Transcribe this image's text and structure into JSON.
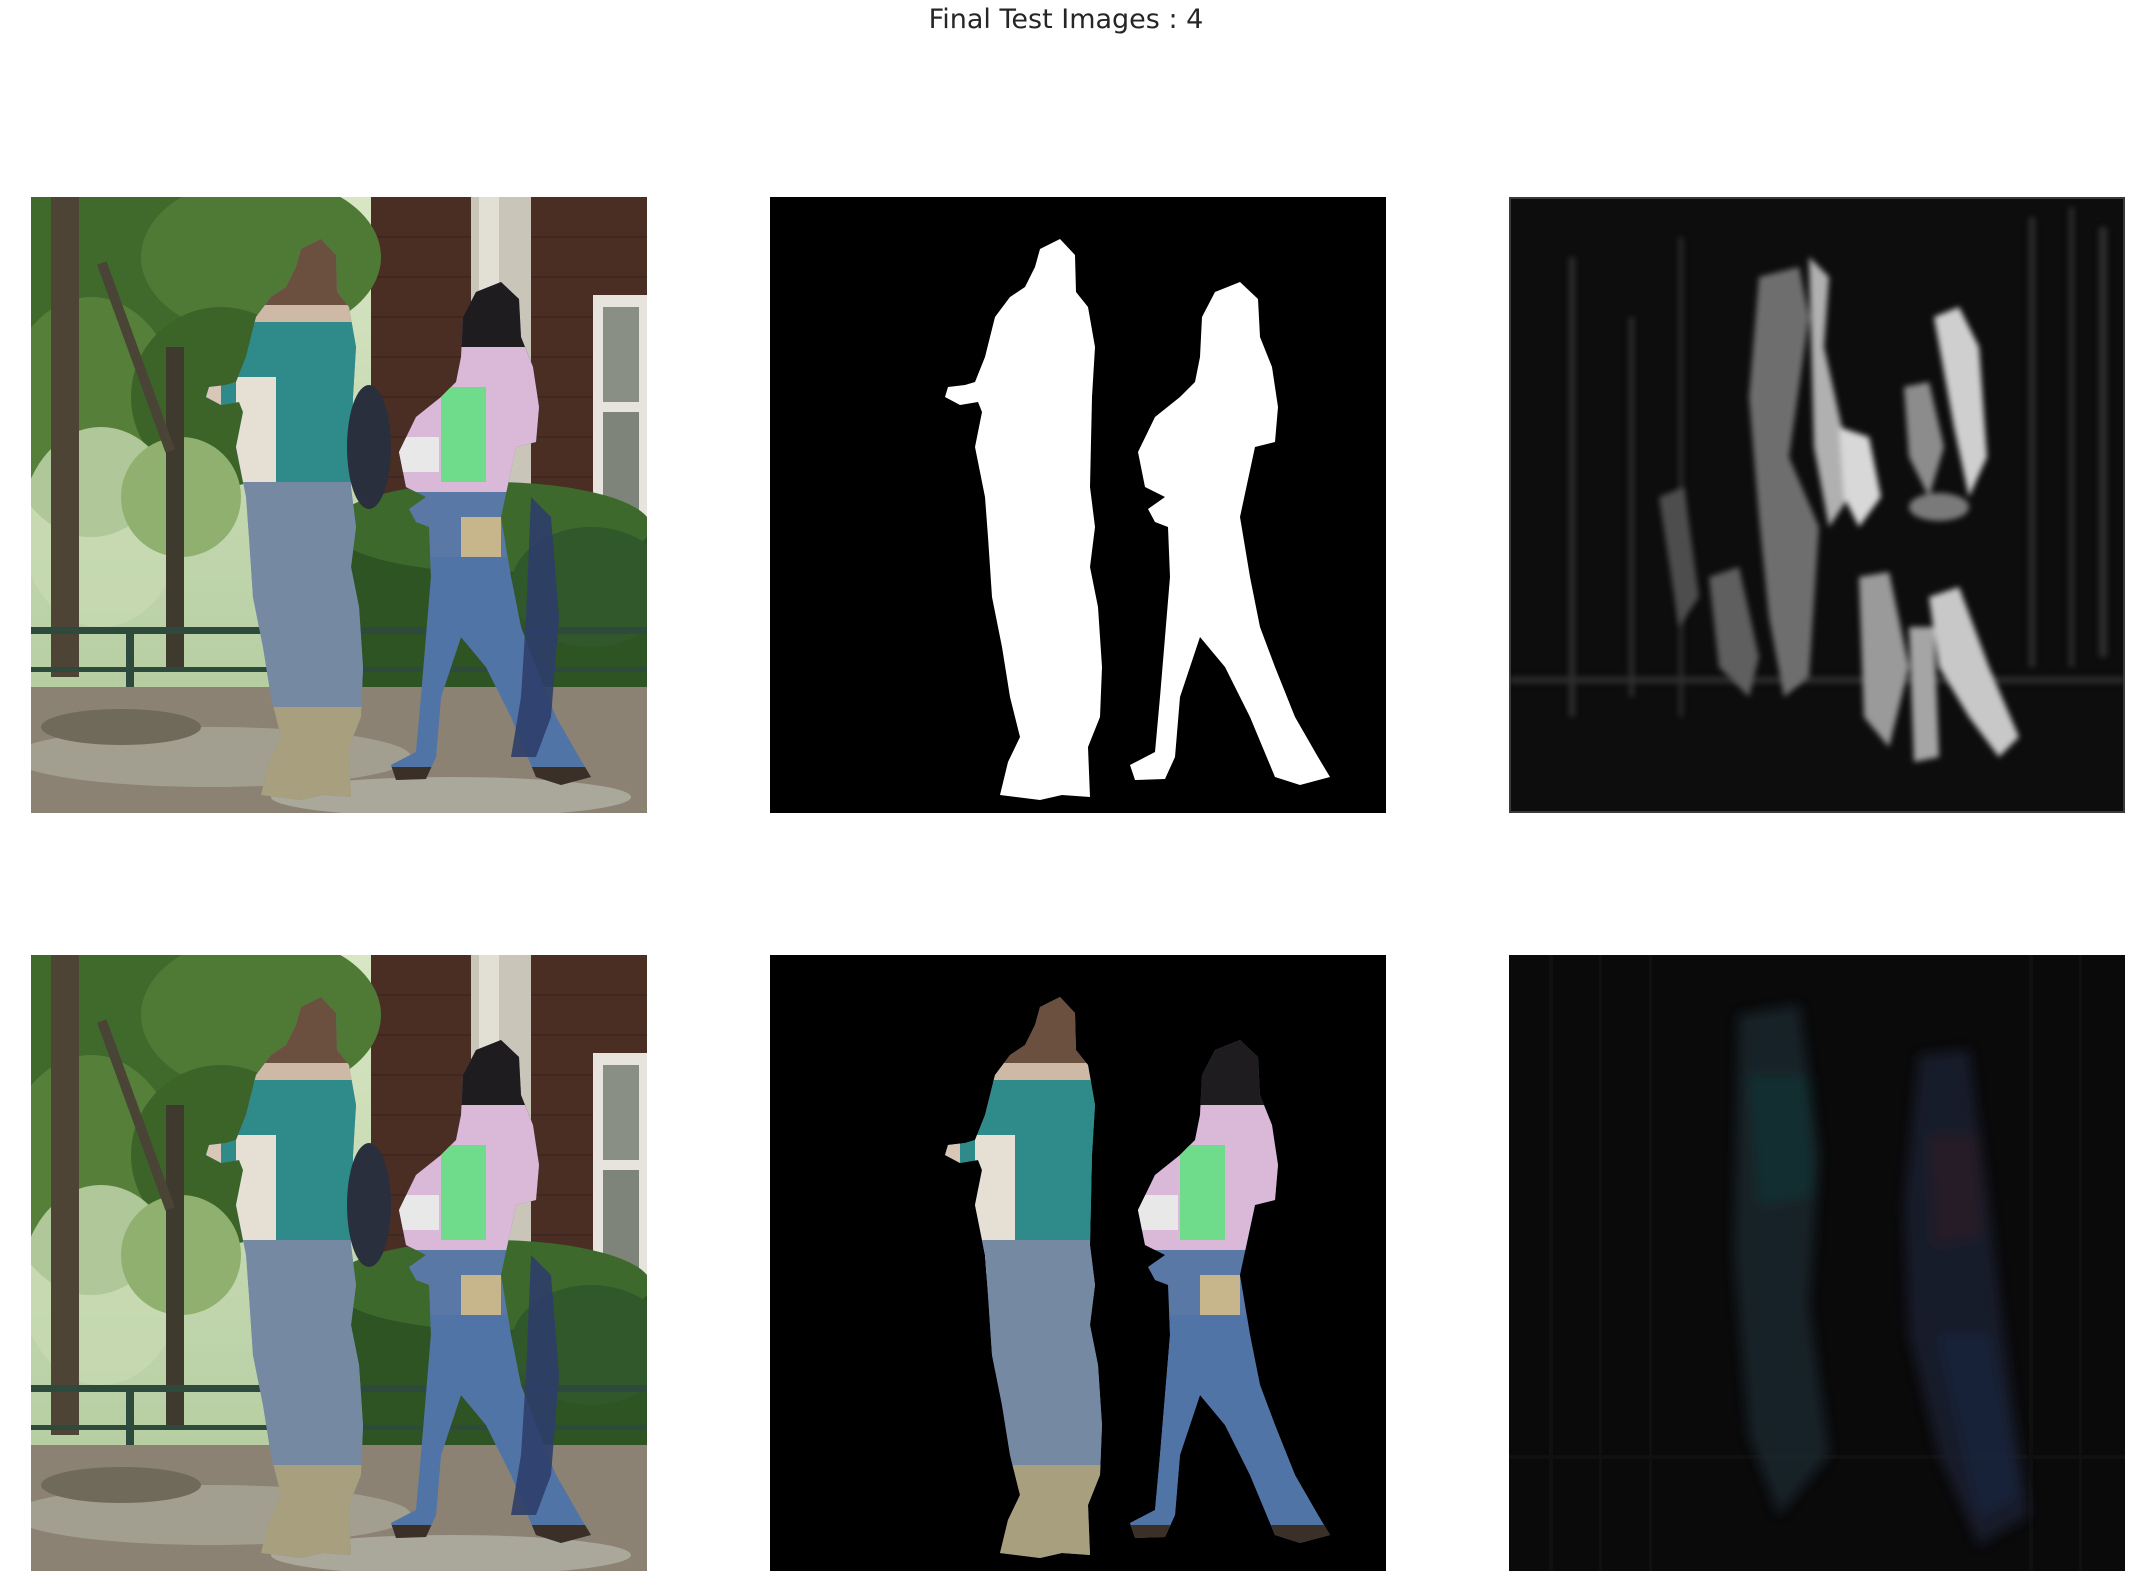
{
  "figure": {
    "title": "Final Test Images : 4"
  },
  "panels": [
    {
      "row": 1,
      "col": 1,
      "content": "input-photo"
    },
    {
      "row": 1,
      "col": 2,
      "content": "binary-mask"
    },
    {
      "row": 1,
      "col": 3,
      "content": "grayscale-response-map"
    },
    {
      "row": 2,
      "col": 1,
      "content": "input-photo"
    },
    {
      "row": 2,
      "col": 2,
      "content": "masked-photo"
    },
    {
      "row": 2,
      "col": 3,
      "content": "dark-residual-map"
    }
  ],
  "colors": {
    "mask_background": "#000000",
    "mask_foreground": "#ffffff",
    "foliage": "#4f7a36",
    "brick": "#4a2e24",
    "teal_jacket": "#2f8a8a",
    "pink_top": "#d9b8d8",
    "green_folder": "#6fdc8c",
    "jeans": "#6f86a8"
  }
}
